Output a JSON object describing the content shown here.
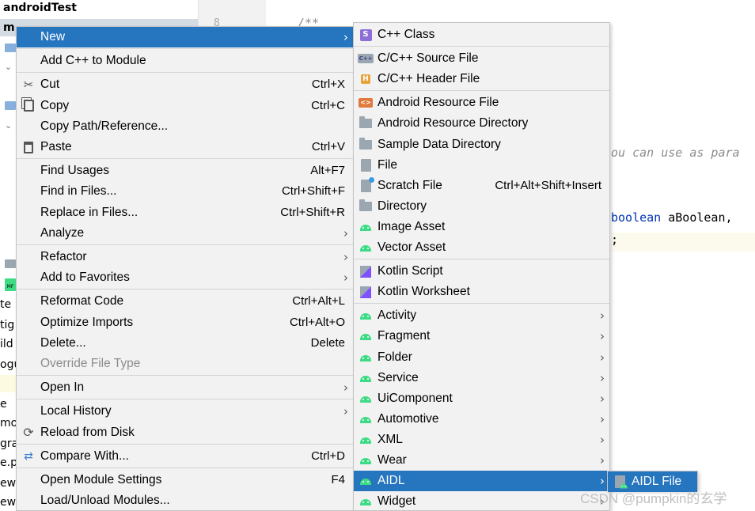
{
  "project": {
    "root_label": "androidTest",
    "selected_label": "m",
    "tree_fragments": [
      "te",
      "tig",
      "ild",
      "ogu",
      "e",
      "mor",
      "gra",
      "e.p",
      "ew",
      "ew"
    ]
  },
  "editor": {
    "line_number": "8",
    "comment_open": "/**",
    "comment_text": "ou can use as para",
    "param_keyword": "boolean",
    "param_rest": " aBoolean, ",
    "semicolon": ";"
  },
  "context_menu": {
    "items": [
      {
        "label": "New",
        "shortcut": "",
        "submenu": true,
        "icon": "",
        "selected": true
      },
      {
        "label": "Add C++ to Module",
        "shortcut": "",
        "submenu": false,
        "icon": ""
      },
      {
        "label": "Cut",
        "shortcut": "Ctrl+X",
        "submenu": false,
        "icon": "scissors-icon"
      },
      {
        "label": "Copy",
        "shortcut": "Ctrl+C",
        "submenu": false,
        "icon": "copy-icon"
      },
      {
        "label": "Copy Path/Reference...",
        "shortcut": "",
        "submenu": false,
        "icon": ""
      },
      {
        "label": "Paste",
        "shortcut": "Ctrl+V",
        "submenu": false,
        "icon": "clipboard-icon"
      },
      {
        "label": "Find Usages",
        "shortcut": "Alt+F7",
        "submenu": false,
        "icon": ""
      },
      {
        "label": "Find in Files...",
        "shortcut": "Ctrl+Shift+F",
        "submenu": false,
        "icon": ""
      },
      {
        "label": "Replace in Files...",
        "shortcut": "Ctrl+Shift+R",
        "submenu": false,
        "icon": ""
      },
      {
        "label": "Analyze",
        "shortcut": "",
        "submenu": true,
        "icon": ""
      },
      {
        "label": "Refactor",
        "shortcut": "",
        "submenu": true,
        "icon": ""
      },
      {
        "label": "Add to Favorites",
        "shortcut": "",
        "submenu": true,
        "icon": ""
      },
      {
        "label": "Reformat Code",
        "shortcut": "Ctrl+Alt+L",
        "submenu": false,
        "icon": ""
      },
      {
        "label": "Optimize Imports",
        "shortcut": "Ctrl+Alt+O",
        "submenu": false,
        "icon": ""
      },
      {
        "label": "Delete...",
        "shortcut": "Delete",
        "submenu": false,
        "icon": ""
      },
      {
        "label": "Override File Type",
        "shortcut": "",
        "submenu": false,
        "icon": "",
        "disabled": true
      },
      {
        "label": "Open In",
        "shortcut": "",
        "submenu": true,
        "icon": ""
      },
      {
        "label": "Local History",
        "shortcut": "",
        "submenu": true,
        "icon": ""
      },
      {
        "label": "Reload from Disk",
        "shortcut": "",
        "submenu": false,
        "icon": "reload-icon"
      },
      {
        "label": "Compare With...",
        "shortcut": "Ctrl+D",
        "submenu": false,
        "icon": "compare-icon"
      },
      {
        "label": "Open Module Settings",
        "shortcut": "F4",
        "submenu": false,
        "icon": ""
      },
      {
        "label": "Load/Unload Modules...",
        "shortcut": "",
        "submenu": false,
        "icon": ""
      }
    ]
  },
  "new_submenu": {
    "items": [
      {
        "label": "C++ Class",
        "shortcut": "",
        "submenu": false,
        "icon": "cpp-class-icon"
      },
      {
        "label": "C/C++ Source File",
        "shortcut": "",
        "submenu": false,
        "icon": "cpp-source-icon"
      },
      {
        "label": "C/C++ Header File",
        "shortcut": "",
        "submenu": false,
        "icon": "cpp-header-icon"
      },
      {
        "label": "Android Resource File",
        "shortcut": "",
        "submenu": false,
        "icon": "resource-file-icon"
      },
      {
        "label": "Android Resource Directory",
        "shortcut": "",
        "submenu": false,
        "icon": "folder-icon"
      },
      {
        "label": "Sample Data Directory",
        "shortcut": "",
        "submenu": false,
        "icon": "folder-icon"
      },
      {
        "label": "File",
        "shortcut": "",
        "submenu": false,
        "icon": "file-icon"
      },
      {
        "label": "Scratch File",
        "shortcut": "Ctrl+Alt+Shift+Insert",
        "submenu": false,
        "icon": "scratch-file-icon"
      },
      {
        "label": "Directory",
        "shortcut": "",
        "submenu": false,
        "icon": "folder-icon"
      },
      {
        "label": "Image Asset",
        "shortcut": "",
        "submenu": false,
        "icon": "android-icon"
      },
      {
        "label": "Vector Asset",
        "shortcut": "",
        "submenu": false,
        "icon": "android-icon"
      },
      {
        "label": "Kotlin Script",
        "shortcut": "",
        "submenu": false,
        "icon": "kotlin-icon"
      },
      {
        "label": "Kotlin Worksheet",
        "shortcut": "",
        "submenu": false,
        "icon": "kotlin-icon"
      },
      {
        "label": "Activity",
        "shortcut": "",
        "submenu": true,
        "icon": "android-icon"
      },
      {
        "label": "Fragment",
        "shortcut": "",
        "submenu": true,
        "icon": "android-icon"
      },
      {
        "label": "Folder",
        "shortcut": "",
        "submenu": true,
        "icon": "android-icon"
      },
      {
        "label": "Service",
        "shortcut": "",
        "submenu": true,
        "icon": "android-icon"
      },
      {
        "label": "UiComponent",
        "shortcut": "",
        "submenu": true,
        "icon": "android-icon"
      },
      {
        "label": "Automotive",
        "shortcut": "",
        "submenu": true,
        "icon": "android-icon"
      },
      {
        "label": "XML",
        "shortcut": "",
        "submenu": true,
        "icon": "android-icon"
      },
      {
        "label": "Wear",
        "shortcut": "",
        "submenu": true,
        "icon": "android-icon"
      },
      {
        "label": "AIDL",
        "shortcut": "",
        "submenu": true,
        "icon": "android-icon",
        "selected": true
      },
      {
        "label": "Widget",
        "shortcut": "",
        "submenu": true,
        "icon": "android-icon"
      }
    ]
  },
  "aidl_submenu": {
    "items": [
      {
        "label": "AIDL File",
        "icon": "aidl-file-icon",
        "selected": true
      }
    ]
  },
  "watermark": "CSDN @pumpkin的玄学",
  "colors": {
    "menu_bg": "#f2f2f2",
    "selection": "#2675bf",
    "android_green": "#3ddc84",
    "keyword_blue": "#0033b3"
  }
}
